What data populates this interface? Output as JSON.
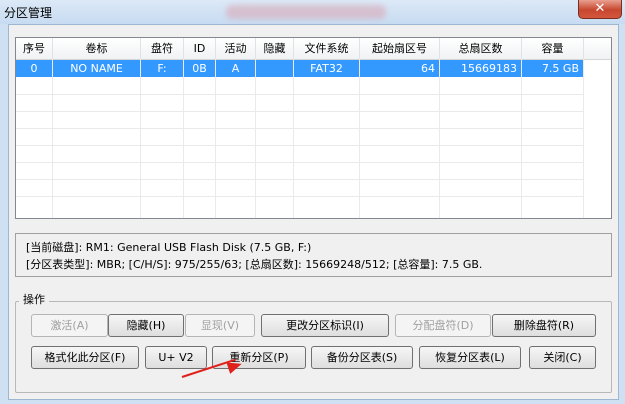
{
  "window": {
    "title": "分区管理",
    "close_glyph": "✕"
  },
  "columns": [
    "序号",
    "卷标",
    "盘符",
    "ID",
    "活动",
    "隐藏",
    "文件系统",
    "起始扇区号",
    "总扇区数",
    "容量"
  ],
  "rows": [
    [
      "0",
      "NO NAME",
      "F:",
      "0B",
      "A",
      "",
      "FAT32",
      "64",
      "15669183",
      "7.5 GB"
    ]
  ],
  "info": {
    "line1": "[当前磁盘]:      RM1: General USB Flash Disk (7.5 GB, F:)",
    "line2": "[分区表类型]:    MBR;      [C/H/S]: 975/255/63; [总扇区数]: 15669248/512; [总容量]: 7.5 GB."
  },
  "group": {
    "title": "操作",
    "row1": [
      "激活(A)",
      "隐藏(H)",
      "显现(V)",
      "更改分区标识(I)",
      "分配盘符(D)",
      "删除盘符(R)"
    ],
    "row2": [
      "格式化此分区(F)",
      "U+ V2",
      "重新分区(P)",
      "备份分区表(S)",
      "恢复分区表(L)",
      "关闭(C)"
    ]
  },
  "colors": {
    "selection": "#3399ff",
    "annotation_arrow": "#e0201a"
  }
}
